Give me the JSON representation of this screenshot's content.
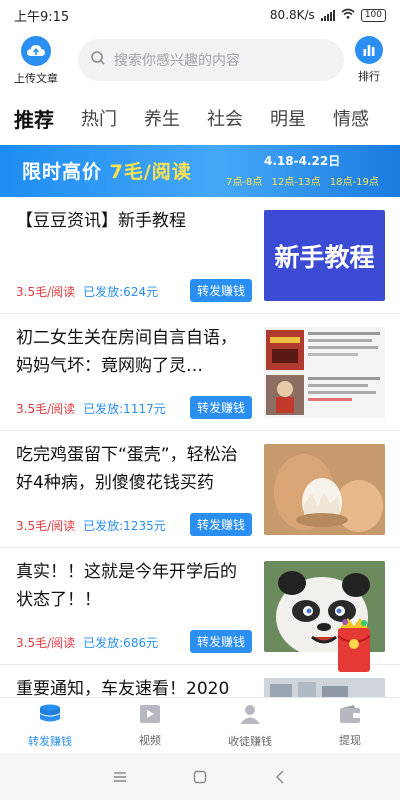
{
  "status": {
    "time": "上午9:15",
    "net_speed": "80.8K/s",
    "battery": "100"
  },
  "header": {
    "upload_label": "上传文章",
    "search_placeholder": "搜索你感兴趣的内容",
    "rank_label": "排行"
  },
  "tabs": [
    {
      "label": "推荐",
      "active": true
    },
    {
      "label": "热门"
    },
    {
      "label": "养生"
    },
    {
      "label": "社会"
    },
    {
      "label": "明星"
    },
    {
      "label": "情感"
    }
  ],
  "banner": {
    "title_prefix": "限时高价",
    "title_highlight": "7毛/阅读",
    "date_range": "4.18-4.22日",
    "times": [
      "7点-8点",
      "12点-13点",
      "18点-19点"
    ]
  },
  "articles": [
    {
      "title": "【豆豆资讯】新手教程",
      "price": "3.5毛/阅读",
      "paid": "已发放:624元",
      "button": "转发赚钱",
      "thumb_text": "新手教程"
    },
    {
      "title": "初二女生关在房间自言自语，妈妈气坏：竟网购了灵…",
      "price": "3.5毛/阅读",
      "paid": "已发放:1117元",
      "button": "转发赚钱"
    },
    {
      "title": "吃完鸡蛋留下“蛋壳”，轻松治好4种病，别傻傻花钱买药",
      "price": "3.5毛/阅读",
      "paid": "已发放:1235元",
      "button": "转发赚钱"
    },
    {
      "title": "真实！！这就是今年开学后的状态了！！",
      "price": "3.5毛/阅读",
      "paid": "已发放:686元",
      "button": "转发赚钱"
    },
    {
      "title": "重要通知，车友速看！2020"
    }
  ],
  "bottom_nav": [
    {
      "label": "转发赚钱",
      "active": true,
      "icon": "coins-icon"
    },
    {
      "label": "视频",
      "icon": "video-icon"
    },
    {
      "label": "收徒赚钱",
      "icon": "user-icon"
    },
    {
      "label": "提现",
      "icon": "wallet-icon"
    }
  ],
  "colors": {
    "accent": "#2a8ff0",
    "price": "#e0383e",
    "banner_highlight": "#ffe34d"
  }
}
